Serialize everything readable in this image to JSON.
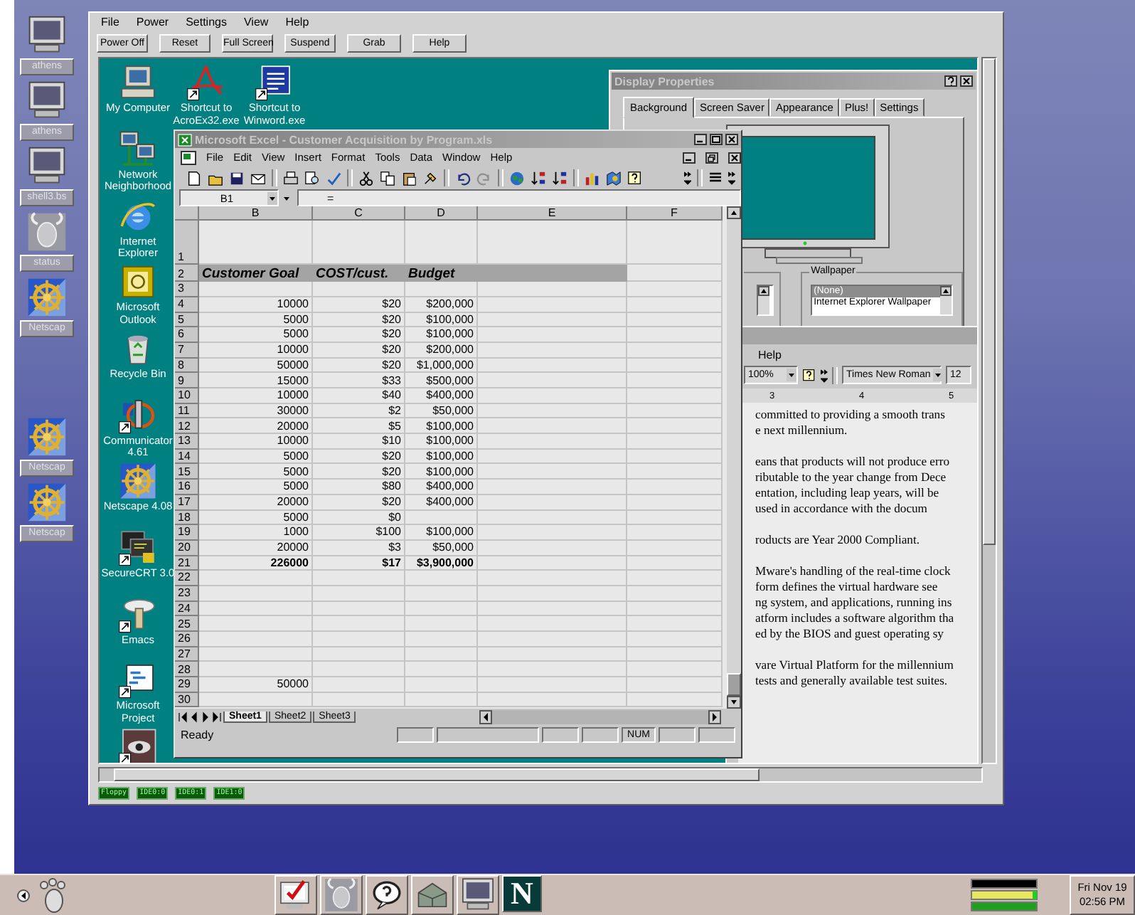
{
  "host_menu": [
    "File",
    "Power",
    "Settings",
    "View",
    "Help"
  ],
  "host_toolbar": [
    "Power Off",
    "Reset",
    "Full Screen",
    "Suspend",
    "Grab",
    "Help"
  ],
  "host_icons": [
    {
      "kind": "monitor",
      "label": "athens"
    },
    {
      "kind": "monitor",
      "label": "athens"
    },
    {
      "kind": "monitor",
      "label": "shell3.bs"
    },
    {
      "kind": "gnu",
      "label": "status"
    },
    {
      "kind": "wheel",
      "label": "Netscap"
    },
    {
      "kind": "wheel",
      "label": "Netscap"
    },
    {
      "kind": "wheel",
      "label": "Netscap"
    }
  ],
  "guest_icons": [
    {
      "kind": "computer",
      "label": "My Computer"
    },
    {
      "kind": "network",
      "label": "Network Neighborhood"
    },
    {
      "kind": "browser",
      "label": "Internet Explorer"
    },
    {
      "kind": "outlook",
      "label": "Microsoft Outlook"
    },
    {
      "kind": "recycle",
      "label": "Recycle Bin"
    },
    {
      "kind": "communicator",
      "label": "Communicator 4.61"
    },
    {
      "kind": "wheel",
      "label": "Netscape 4.08"
    },
    {
      "kind": "terminal",
      "label": "SecureCRT 3.0"
    },
    {
      "kind": "emacs",
      "label": "Emacs"
    },
    {
      "kind": "project",
      "label": "Microsoft Project"
    },
    {
      "kind": "eye"
    }
  ],
  "guest_shortcuts": [
    {
      "kind": "acrobat",
      "label": "Shortcut to AcroEx32.exe"
    },
    {
      "kind": "word",
      "label": "Shortcut to Winword.exe"
    }
  ],
  "display_properties": {
    "title": "Display Properties",
    "tabs": [
      {
        "label": "Background",
        "selected": true
      },
      {
        "label": "Screen Saver",
        "selected": false
      },
      {
        "label": "Appearance",
        "selected": false
      },
      {
        "label": "Plus!",
        "selected": false
      },
      {
        "label": "Settings",
        "selected": false
      }
    ],
    "wallpaper": {
      "legend": "Wallpaper",
      "items": [
        {
          "label": "(None)",
          "selected": true
        },
        {
          "label": "Internet Explorer Wallpaper",
          "selected": false
        }
      ]
    }
  },
  "word": {
    "menu": [
      "Help"
    ],
    "zoom": "100%",
    "font": "Times New Roman",
    "size": "12",
    "ruler": [
      "3",
      "4",
      "5"
    ],
    "paragraphs": [
      [
        "committed to providing a smooth trans",
        "e next millennium."
      ],
      [
        "eans that products will not produce erro",
        "ributable to the year change from Dece",
        "entation, including leap years, will be",
        "used in accordance with the docum"
      ],
      [
        "roducts are Year 2000 Compliant."
      ],
      [
        "Mware's handling of the real-time clock",
        "form defines the virtual hardware see",
        "ng system, and applications, running ins",
        "atform includes a software algorithm tha",
        "ed by the BIOS and guest operating sy"
      ],
      [
        "vare Virtual Platform for the millennium",
        "tests and generally available test suites."
      ]
    ]
  },
  "excel": {
    "title": "Microsoft Excel - Customer Acquisition by Program.xls",
    "menu": [
      "File",
      "Edit",
      "View",
      "Insert",
      "Format",
      "Tools",
      "Data",
      "Window",
      "Help"
    ],
    "name_box": "B1",
    "formula_sign": "=",
    "columns": [
      "B",
      "C",
      "D",
      "E",
      "F"
    ],
    "rows": [
      {
        "number": "1",
        "kind": "data"
      },
      {
        "number": "2",
        "kind": "header",
        "cells": [
          "Customer Goal",
          "COST/cust.",
          "Budget"
        ]
      },
      {
        "number": "3",
        "kind": "data"
      },
      {
        "number": "4",
        "kind": "data",
        "cells": [
          "10000",
          "$20",
          "$200,000"
        ]
      },
      {
        "number": "5",
        "kind": "data",
        "cells": [
          "5000",
          "$20",
          "$100,000"
        ]
      },
      {
        "number": "6",
        "kind": "data",
        "cells": [
          "5000",
          "$20",
          "$100,000"
        ]
      },
      {
        "number": "7",
        "kind": "data",
        "cells": [
          "10000",
          "$20",
          "$200,000"
        ]
      },
      {
        "number": "8",
        "kind": "data",
        "cells": [
          "50000",
          "$20",
          "$1,000,000"
        ]
      },
      {
        "number": "9",
        "kind": "data",
        "cells": [
          "15000",
          "$33",
          "$500,000"
        ]
      },
      {
        "number": "10",
        "kind": "data",
        "cells": [
          "10000",
          "$40",
          "$400,000"
        ]
      },
      {
        "number": "11",
        "kind": "data",
        "cells": [
          "30000",
          "$2",
          "$50,000"
        ]
      },
      {
        "number": "12",
        "kind": "data",
        "cells": [
          "20000",
          "$5",
          "$100,000"
        ]
      },
      {
        "number": "13",
        "kind": "data",
        "cells": [
          "10000",
          "$10",
          "$100,000"
        ]
      },
      {
        "number": "14",
        "kind": "data",
        "cells": [
          "5000",
          "$20",
          "$100,000"
        ]
      },
      {
        "number": "15",
        "kind": "data",
        "cells": [
          "5000",
          "$20",
          "$100,000"
        ]
      },
      {
        "number": "16",
        "kind": "data",
        "cells": [
          "5000",
          "$80",
          "$400,000"
        ]
      },
      {
        "number": "17",
        "kind": "data",
        "cells": [
          "20000",
          "$20",
          "$400,000"
        ]
      },
      {
        "number": "18",
        "kind": "data",
        "cells": [
          "5000",
          "$0"
        ]
      },
      {
        "number": "19",
        "kind": "data",
        "cells": [
          "1000",
          "$100",
          "$100,000"
        ]
      },
      {
        "number": "20",
        "kind": "data",
        "cells": [
          "20000",
          "$3",
          "$50,000"
        ]
      },
      {
        "number": "21",
        "kind": "total",
        "cells": [
          "226000",
          "$17",
          "$3,900,000"
        ]
      },
      {
        "number": "22",
        "kind": "data"
      },
      {
        "number": "23",
        "kind": "data"
      },
      {
        "number": "24",
        "kind": "data"
      },
      {
        "number": "25",
        "kind": "data"
      },
      {
        "number": "26",
        "kind": "data"
      },
      {
        "number": "27",
        "kind": "data"
      },
      {
        "number": "28",
        "kind": "data"
      },
      {
        "number": "29",
        "kind": "data",
        "cells": [
          "50000"
        ]
      },
      {
        "number": "30",
        "kind": "data"
      }
    ],
    "sheet_tabs": [
      {
        "label": "Sheet1",
        "selected": true
      },
      {
        "label": "Sheet2",
        "selected": false
      },
      {
        "label": "Sheet3",
        "selected": false
      }
    ],
    "status": "Ready",
    "indicators": [
      "NUM"
    ]
  },
  "device_indicators": [
    "Floppy",
    "IDE0:0",
    "IDE0:1",
    "IDE1:0"
  ],
  "taskbar": {
    "launchers": [
      {
        "kind": "checklist"
      },
      {
        "kind": "gnu"
      },
      {
        "kind": "help"
      },
      {
        "kind": "box"
      },
      {
        "kind": "monitor"
      },
      {
        "kind": "netscape",
        "letter": "N"
      }
    ],
    "clock": {
      "date": "Fri Nov 19",
      "time": "02:56 PM"
    }
  }
}
